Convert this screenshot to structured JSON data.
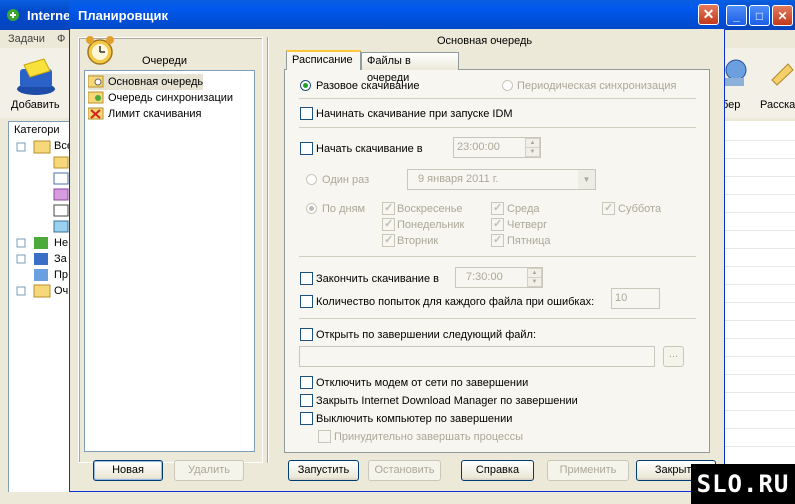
{
  "background_app": {
    "title": "Interne",
    "menu": [
      "Задачи",
      "Ф"
    ],
    "toolbar": {
      "add_label": "Добавить",
      "right_labels": [
        "бер",
        "Расска"
      ]
    },
    "tree": {
      "header": "Категори",
      "items": [
        "Все",
        "Не",
        "За",
        "Пр",
        "Оч"
      ]
    }
  },
  "dialog": {
    "title": "Планировщик",
    "close_glyph": "✕",
    "left": {
      "queues_label": "Очереди",
      "queues": [
        {
          "label": "Основная очередь",
          "selected": true
        },
        {
          "label": "Очередь синхронизации",
          "selected": false
        },
        {
          "label": "Лимит скачивания",
          "selected": false
        }
      ],
      "new_button": "Новая",
      "delete_button": "Удалить"
    },
    "queue_title": "Основная очередь",
    "tabs": [
      {
        "label": "Расписание",
        "active": true
      },
      {
        "label": "Файлы в очереди",
        "active": false
      }
    ],
    "schedule": {
      "one_time": "Разовое скачивание",
      "periodic": "Периодическая синхронизация",
      "start_on_launch": "Начинать скачивание при запуске IDM",
      "start_at": "Начать скачивание в",
      "start_time": "23:00:00",
      "once": "Один раз",
      "date_value": "9   января   2011 г.",
      "by_days": "По дням",
      "days": [
        {
          "label": "Воскресенье",
          "checked": true
        },
        {
          "label": "Среда",
          "checked": true
        },
        {
          "label": "Суббота",
          "checked": true
        },
        {
          "label": "Понедельник",
          "checked": true
        },
        {
          "label": "Четверг",
          "checked": true
        },
        {
          "label": "Вторник",
          "checked": true
        },
        {
          "label": "Пятница",
          "checked": true
        }
      ],
      "stop_at": "Закончить скачивание в",
      "stop_time": "7:30:00",
      "retries_label": "Количество попыток для каждого файла при ошибках:",
      "retries_value": "10",
      "open_file": "Открыть по завершении следующий файл:",
      "browse": "...",
      "hangup": "Отключить модем от сети по завершении",
      "exit_idm": "Закрыть Internet Download Manager по завершении",
      "shutdown": "Выключить компьютер по завершении",
      "force_kill": "Принудительно завершать процессы"
    },
    "buttons": {
      "start": "Запустить",
      "stop": "Остановить",
      "help": "Справка",
      "apply": "Применить",
      "close": "Закрыть"
    }
  },
  "watermark": "SLO.RU"
}
